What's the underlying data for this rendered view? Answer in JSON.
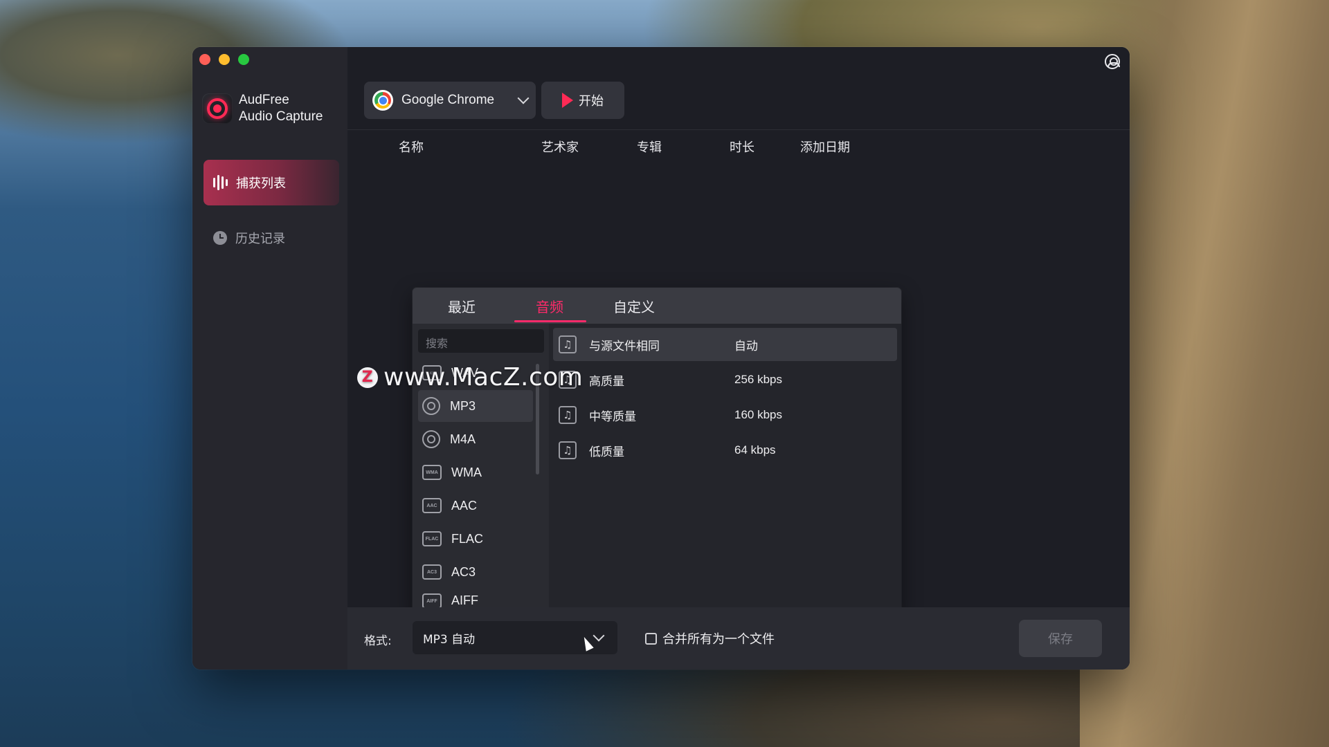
{
  "app": {
    "name_line1": "AudFree",
    "name_line2": "Audio Capture"
  },
  "sidebar": {
    "items": [
      {
        "label": "捕获列表",
        "active": true
      },
      {
        "label": "历史记录",
        "active": false
      }
    ]
  },
  "toolbar": {
    "source_app": "Google Chrome",
    "start_label": "开始"
  },
  "table": {
    "columns": [
      "名称",
      "艺术家",
      "专辑",
      "时长",
      "添加日期"
    ]
  },
  "format_popup": {
    "tabs": [
      "最近",
      "音频",
      "自定义"
    ],
    "active_tab": "音频",
    "search_placeholder": "搜索",
    "formats": [
      {
        "label": "WAV",
        "icon": "cassette-icon"
      },
      {
        "label": "MP3",
        "icon": "disc-note-icon",
        "selected": true
      },
      {
        "label": "M4A",
        "icon": "disc-note-icon"
      },
      {
        "label": "WMA",
        "icon": "wma-badge-icon"
      },
      {
        "label": "AAC",
        "icon": "aac-badge-icon"
      },
      {
        "label": "FLAC",
        "icon": "flac-badge-icon"
      },
      {
        "label": "AC3",
        "icon": "ac3-badge-icon"
      },
      {
        "label": "AIFF",
        "icon": "aiff-badge-icon"
      }
    ],
    "qualities": [
      {
        "label": "与源文件相同",
        "value": "自动",
        "selected": true
      },
      {
        "label": "高质量",
        "value": "256 kbps"
      },
      {
        "label": "中等质量",
        "value": "160 kbps"
      },
      {
        "label": "低质量",
        "value": "64 kbps"
      }
    ]
  },
  "watermark": {
    "text": "www.MacZ.com",
    "logo_letter": "Z"
  },
  "bottom_bar": {
    "format_label": "格式:",
    "format_value": "MP3 自动",
    "merge_label": "合并所有为一个文件",
    "save_label": "保存"
  },
  "colors": {
    "accent": "#ff2a6a",
    "window_bg": "#1d1e25",
    "sidebar_bg": "#26262d"
  }
}
